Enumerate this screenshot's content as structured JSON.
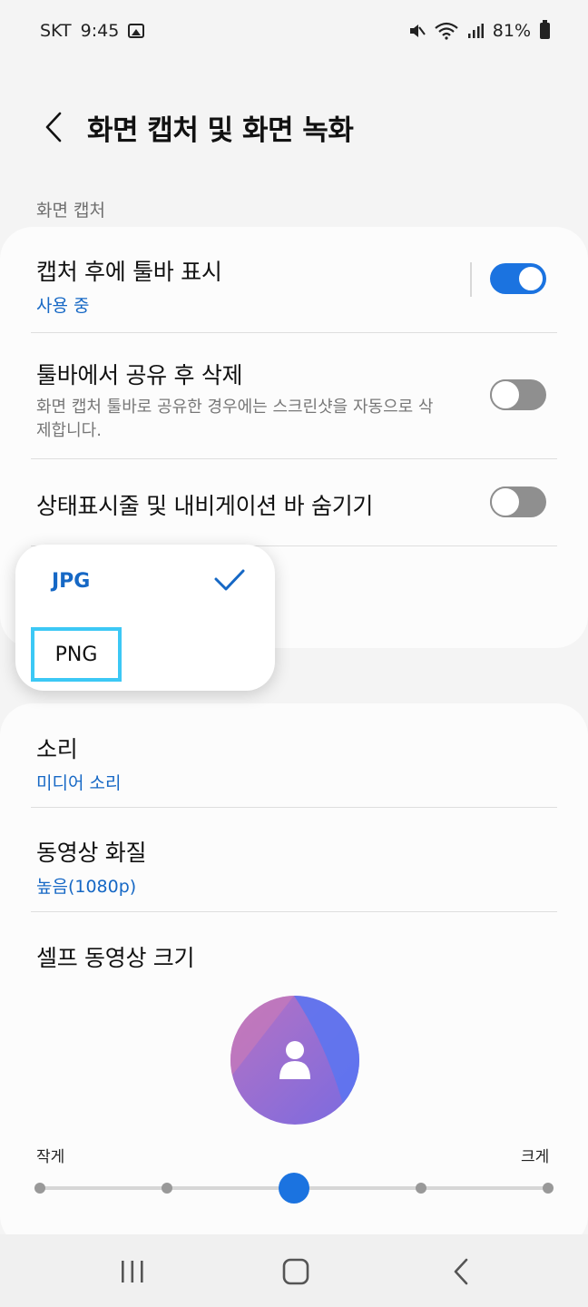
{
  "status_bar": {
    "carrier": "SKT",
    "time": "9:45",
    "battery": "81%",
    "icons": [
      "gallery-icon",
      "mute-icon",
      "wifi-icon",
      "signal-icon",
      "battery-icon"
    ]
  },
  "header": {
    "title": "화면 캡처 및 화면 녹화",
    "back_icon": "chevron-left-icon"
  },
  "capture_section": {
    "label": "화면 캡처",
    "items": [
      {
        "title": "캡처 후에 툴바 표시",
        "subtitle": "사용 중",
        "toggle": "on"
      },
      {
        "title": "툴바에서 공유 후 삭제",
        "description": "화면 캡처 툴바로 공유한 경우에는 스크린샷을 자동으로 삭제합니다.",
        "toggle": "off"
      },
      {
        "title": "상태표시줄 및 내비게이션 바 숨기기",
        "toggle": "off"
      }
    ]
  },
  "format_popup": {
    "options": [
      "JPG",
      "PNG"
    ],
    "selected": "JPG",
    "highlighted": "PNG"
  },
  "record_section": {
    "items": [
      {
        "title": "소리",
        "subtitle": "미디어 소리"
      },
      {
        "title": "동영상 화질",
        "subtitle": "높음(1080p)"
      },
      {
        "title": "셀프 동영상 크기"
      }
    ],
    "slider": {
      "min_label": "작게",
      "max_label": "크게",
      "steps": 5,
      "value_index": 2
    }
  },
  "colors": {
    "accent": "#1b73e0",
    "subtitle": "#1668c5",
    "highlight": "#3cc8f5"
  }
}
